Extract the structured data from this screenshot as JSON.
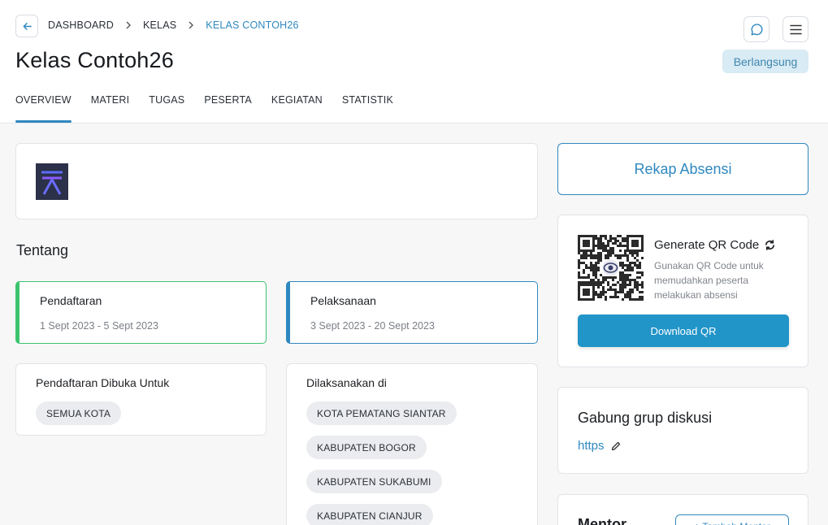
{
  "breadcrumb": [
    "DASHBOARD",
    "KELAS",
    "KELAS CONTOH26"
  ],
  "title": "Kelas Contoh26",
  "status": "Berlangsung",
  "tabs": [
    "OVERVIEW",
    "MATERI",
    "TUGAS",
    "PESERTA",
    "KEGIATAN",
    "STATISTIK"
  ],
  "active_tab": "OVERVIEW",
  "about": {
    "heading": "Tentang",
    "registration": {
      "title": "Pendaftaran",
      "range": "1 Sept 2023 - 5 Sept 2023"
    },
    "execution": {
      "title": "Pelaksanaan",
      "range": "3 Sept 2023 - 20 Sept 2023"
    },
    "open_for": {
      "title": "Pendaftaran Dibuka Untuk",
      "chips": [
        "SEMUA KOTA"
      ]
    },
    "held_in": {
      "title": "Dilaksanakan di",
      "chips": [
        "KOTA PEMATANG SIANTAR",
        "KABUPATEN BOGOR",
        "KABUPATEN SUKABUMI",
        "KABUPATEN CIANJUR"
      ]
    }
  },
  "sidebar": {
    "rekap_label": "Rekap Absensi",
    "qr": {
      "title": "Generate QR Code",
      "description": "Gunakan QR Code untuk memudahkan peserta melakukan absensi",
      "download_label": "Download QR"
    },
    "discussion": {
      "title": "Gabung grup diskusi",
      "link": "https"
    },
    "mentor": {
      "title": "Mentor",
      "button": "+ Tambah Mentor"
    }
  },
  "colors": {
    "accent": "#2f88bf",
    "green": "#3cc36e",
    "badge_bg": "#d9ebf4",
    "download_bg": "#2194c8"
  }
}
